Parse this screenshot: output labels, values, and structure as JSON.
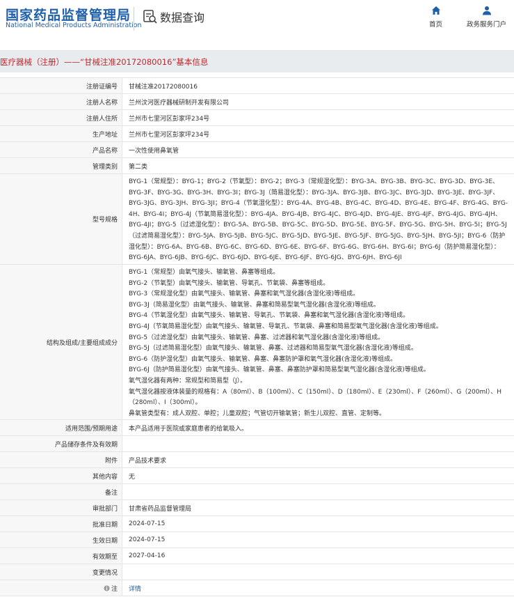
{
  "header": {
    "logo_cn": "国家药品监督管理局",
    "logo_en": "National Medical Products Administration",
    "search_title": "数据查询",
    "nav_home": "首页",
    "nav_service": "政务服务门户"
  },
  "banner": {
    "title": "医疗器械（注册）——“甘械注准20172080016”基本信息"
  },
  "rows": {
    "reg_no": {
      "label": "注册证编号",
      "value": "甘械注准20172080016"
    },
    "registrant": {
      "label": "注册人名称",
      "value": "兰州汶河医疗器械研制开发有限公司"
    },
    "registrant_addr": {
      "label": "注册人住所",
      "value": "兰州市七里河区彭家坪234号"
    },
    "prod_addr": {
      "label": "生产地址",
      "value": "兰州市七里河区彭家坪234号"
    },
    "product": {
      "label": "产品名称",
      "value": "一次性使用鼻氧管"
    },
    "category": {
      "label": "管理类别",
      "value": "第二类"
    },
    "model": {
      "label": "型号规格",
      "value": "BYG-1（常规型）：BYG-1；BYG-2（节氧型）：BYG-2；BYG-3（常规湿化型）：BYG-3A、BYG-3B、BYG-3C、BYG-3D、BYG-3E、BYG-3F、BYG-3G、BYG-3H、BYG-3I；BYG-3J（简易湿化型）：BYG-3JA、BYG-3JB、BYG-3JC、BYG-3JD、BYG-3JE、BYG-3JF、BYG-3JG、BYG-3JH、BYG-3JI；BYG-4（节氧湿化型）：BYG-4A、BYG-4B、BYG-4C、BYG-4D、BYG-4E、BYG-4F、BYG-4G、BYG-4H、BYG-4I；BYG-4J（节氧简易湿化型）：BYG-4JA、BYG-4JB、BYG-4JC、BYG-4JD、BYG-4JE、BYG-4JF、BYG-4JG、BYG-4JH、BYG-4JI；BYG-5（过滤湿化型）：BYG-5A、BYG-5B、BYG-5C、BYG-5D、BYG-5E、BYG-5F、BYG-5G、BYG-5H、BYG-5I；BYG-5J（过滤简易湿化型）：BYG-5JA、BYG-5JB、BYG-5JC、BYG-5JD、BYG-5JE、BYG-5JF、BYG-5JG、BYG-5JH、BYG-5JI；BYG-6（防护湿化型）：BYG-6A、BYG-6B、BYG-6C、BYG-6D、BYG-6E、BYG-6F、BYG-6G、BYG-6H、BYG-6I；BYG-6J（防护简易湿化型）：BYG-6JA、BYG-6JB、BYG-6JC、BYG-6JD、BYG-6JE、BYG-6JF、BYG-6JG、BYG-6JH、BYG-6JI"
    },
    "structure": {
      "label": "结构及组成/主要组成成分",
      "lines": [
        "BYG-1（常规型）由氧气接头、输氧管、鼻塞等组成。",
        "BYG-2（节氧型）由氧气接头、输氧管、导氧孔、节氧袋、鼻塞等组成。",
        "BYG-3（常规湿化型）由氧气接头、输氧管、鼻塞和氧气湿化器(含湿化液)等组成。",
        "BYG-3J（简易湿化型）由氧气接头、输氧管、鼻塞和简易型氧气湿化器(含湿化液)等组成。",
        "BYG-4（节氧湿化型）由氧气接头、输氧管、导氧孔、节氧袋、鼻塞和氧气湿化器(含湿化液)等组成。",
        "BYG-4J（节氧简易湿化型）由氧气接头、输氧管、导氧孔、节氧袋、鼻塞和简易型氧气湿化器(含湿化液)等组成。",
        "BYG-5（过滤湿化型）由氧气接头、输氧管、鼻塞、过滤器和氧气湿化器(含湿化液)等组成。",
        "BYG-5J（过滤简易湿化型）由氧气接头、输氧管、鼻塞、过滤器和简易型氧气湿化器(含湿化液)等组成。",
        "BYG-6（防护湿化型）由氧气接头、输氧管、鼻塞、鼻塞防护罩和氧气湿化器(含湿化液)等组成。",
        "BYG-6J（防护简易湿化型）由氧气接头、输氧管、鼻塞、鼻塞防护罩和简易型氧气湿化器(含湿化液)等组成。",
        "氧气湿化器有两种：常规型和简易型（J）。",
        "氧气湿化器按液体装量的规格有：A（80ml）、B（100ml）、C（150ml）、D（180ml）、E（230ml）、F（260ml）、G（200ml）、H（280ml）、I（300ml）。",
        "鼻氧管类型有：成人双腔、单腔；儿童双腔；气管切开输氧管；新生儿双腔、直管、定制等。"
      ]
    },
    "scope": {
      "label": "适用范围/预期用途",
      "value": "本产品适用于医院或家庭患者的给氧吸入。"
    },
    "storage": {
      "label": "产品储存条件及有效期",
      "value": ""
    },
    "attachment": {
      "label": "附件",
      "value": "产品技术要求"
    },
    "other": {
      "label": "其他内容",
      "value": "无"
    },
    "remark": {
      "label": "备注",
      "value": ""
    },
    "approver": {
      "label": "审批部门",
      "value": "甘肃省药品监督管理局"
    },
    "approve_date": {
      "label": "批准日期",
      "value": "2024-07-15"
    },
    "effective_date": {
      "label": "生效日期",
      "value": "2024-07-15"
    },
    "expire_date": {
      "label": "有效期至",
      "value": "2027-04-16"
    },
    "change": {
      "label": "变更情况",
      "value": ""
    },
    "note": {
      "label": "注",
      "value": "详情"
    }
  }
}
